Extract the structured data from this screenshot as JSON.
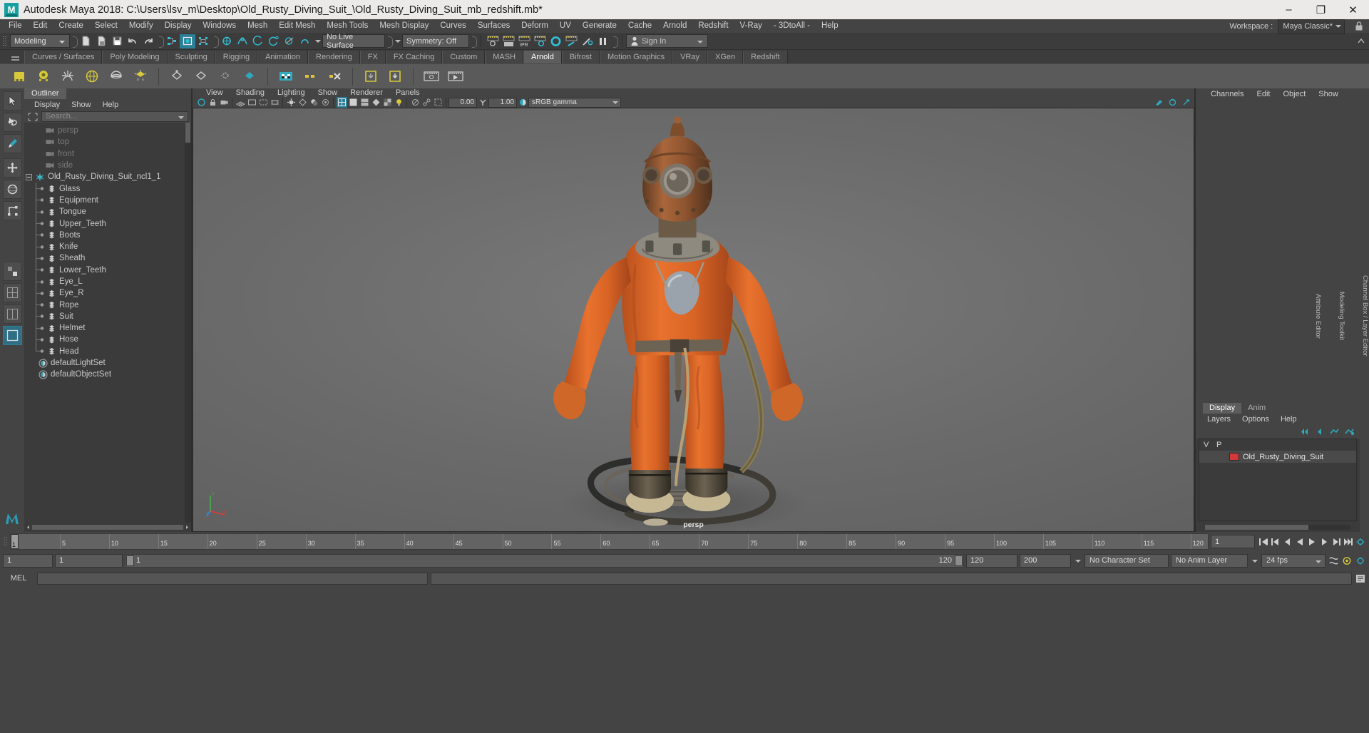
{
  "window": {
    "title": "Autodesk Maya 2018: C:\\Users\\lsv_m\\Desktop\\Old_Rusty_Diving_Suit_\\Old_Rusty_Diving_Suit_mb_redshift.mb*",
    "logo_text": "M",
    "minimize": "–",
    "maximize": "❐",
    "close": "✕"
  },
  "menubar": {
    "items": [
      "File",
      "Edit",
      "Create",
      "Select",
      "Modify",
      "Display",
      "Windows",
      "Mesh",
      "Edit Mesh",
      "Mesh Tools",
      "Mesh Display",
      "Curves",
      "Surfaces",
      "Deform",
      "UV",
      "Generate",
      "Cache",
      "Arnold",
      "Redshift",
      "V-Ray",
      "- 3DtoAll -",
      "Help"
    ],
    "workspace_label": "Workspace :",
    "workspace_value": "Maya Classic*"
  },
  "statusline": {
    "mode": "Modeling",
    "live_surface": "No Live Surface",
    "symmetry": "Symmetry: Off",
    "signin": "Sign In"
  },
  "shelf": {
    "tabs": [
      "Curves / Surfaces",
      "Poly Modeling",
      "Sculpting",
      "Rigging",
      "Animation",
      "Rendering",
      "FX",
      "FX Caching",
      "Custom",
      "MASH",
      "Arnold",
      "Bifrost",
      "Motion Graphics",
      "VRay",
      "XGen",
      "Redshift"
    ],
    "active_tab": "Arnold"
  },
  "outliner": {
    "tab": "Outliner",
    "menu": [
      "Display",
      "Show",
      "Help"
    ],
    "search_placeholder": "Search...",
    "items": [
      {
        "label": "persp",
        "type": "camera",
        "depth": 1
      },
      {
        "label": "top",
        "type": "camera",
        "depth": 1
      },
      {
        "label": "front",
        "type": "camera",
        "depth": 1
      },
      {
        "label": "side",
        "type": "camera",
        "depth": 1
      },
      {
        "label": "Old_Rusty_Diving_Suit_ncl1_1",
        "type": "group",
        "depth": 0
      },
      {
        "label": "Glass",
        "type": "mesh",
        "depth": 1
      },
      {
        "label": "Equipment",
        "type": "mesh",
        "depth": 1
      },
      {
        "label": "Tongue",
        "type": "mesh",
        "depth": 1
      },
      {
        "label": "Upper_Teeth",
        "type": "mesh",
        "depth": 1
      },
      {
        "label": "Boots",
        "type": "mesh",
        "depth": 1
      },
      {
        "label": "Knife",
        "type": "mesh",
        "depth": 1
      },
      {
        "label": "Sheath",
        "type": "mesh",
        "depth": 1
      },
      {
        "label": "Lower_Teeth",
        "type": "mesh",
        "depth": 1
      },
      {
        "label": "Eye_L",
        "type": "mesh",
        "depth": 1
      },
      {
        "label": "Eye_R",
        "type": "mesh",
        "depth": 1
      },
      {
        "label": "Rope",
        "type": "mesh",
        "depth": 1
      },
      {
        "label": "Suit",
        "type": "mesh",
        "depth": 1
      },
      {
        "label": "Helmet",
        "type": "mesh",
        "depth": 1
      },
      {
        "label": "Hose",
        "type": "mesh",
        "depth": 1
      },
      {
        "label": "Head",
        "type": "mesh",
        "depth": 1,
        "last": true
      },
      {
        "label": "defaultLightSet",
        "type": "set",
        "depth": 0.5
      },
      {
        "label": "defaultObjectSet",
        "type": "set",
        "depth": 0.5
      }
    ]
  },
  "viewport": {
    "menu": [
      "View",
      "Shading",
      "Lighting",
      "Show",
      "Renderer",
      "Panels"
    ],
    "exposure": "0.00",
    "gamma": "1.00",
    "color_space": "sRGB gamma",
    "camera_label": "persp",
    "axis": {
      "x": "X",
      "y": "Y",
      "z": "Z"
    }
  },
  "channelbox": {
    "tabs": [
      "Channels",
      "Edit",
      "Object",
      "Show"
    ],
    "side_labels": [
      "Channel Box / Layer Editor",
      "Modeling Toolkit",
      "Attribute Editor"
    ]
  },
  "layers": {
    "tabs": [
      "Display",
      "Anim"
    ],
    "active_tab": "Display",
    "menu": [
      "Layers",
      "Options",
      "Help"
    ],
    "columns": [
      "V",
      "P"
    ],
    "rows": [
      {
        "v": "",
        "p": "",
        "color": "#d03a3a",
        "name": "Old_Rusty_Diving_Suit"
      }
    ]
  },
  "timeline": {
    "current_frame": "1",
    "start_tick": "1",
    "ticks": [
      "5",
      "10",
      "15",
      "20",
      "25",
      "30",
      "35",
      "40",
      "45",
      "50",
      "55",
      "60",
      "65",
      "70",
      "75",
      "80",
      "85",
      "90",
      "95",
      "100",
      "105",
      "110",
      "115",
      "120"
    ],
    "frame_field": "1"
  },
  "range": {
    "anim_start": "1",
    "range_start": "1",
    "playback_start": "1",
    "playback_end": "120",
    "range_end": "120",
    "anim_end": "200",
    "character_set": "No Character Set",
    "anim_layer": "No Anim Layer",
    "fps": "24 fps"
  },
  "mel": {
    "label": "MEL"
  },
  "colors": {
    "accent": "#2b7f96",
    "layer_red": "#d03a3a",
    "panel_bg": "#444444",
    "outliner_bg": "#3b3b3b",
    "title_bg": "#eceae8"
  }
}
